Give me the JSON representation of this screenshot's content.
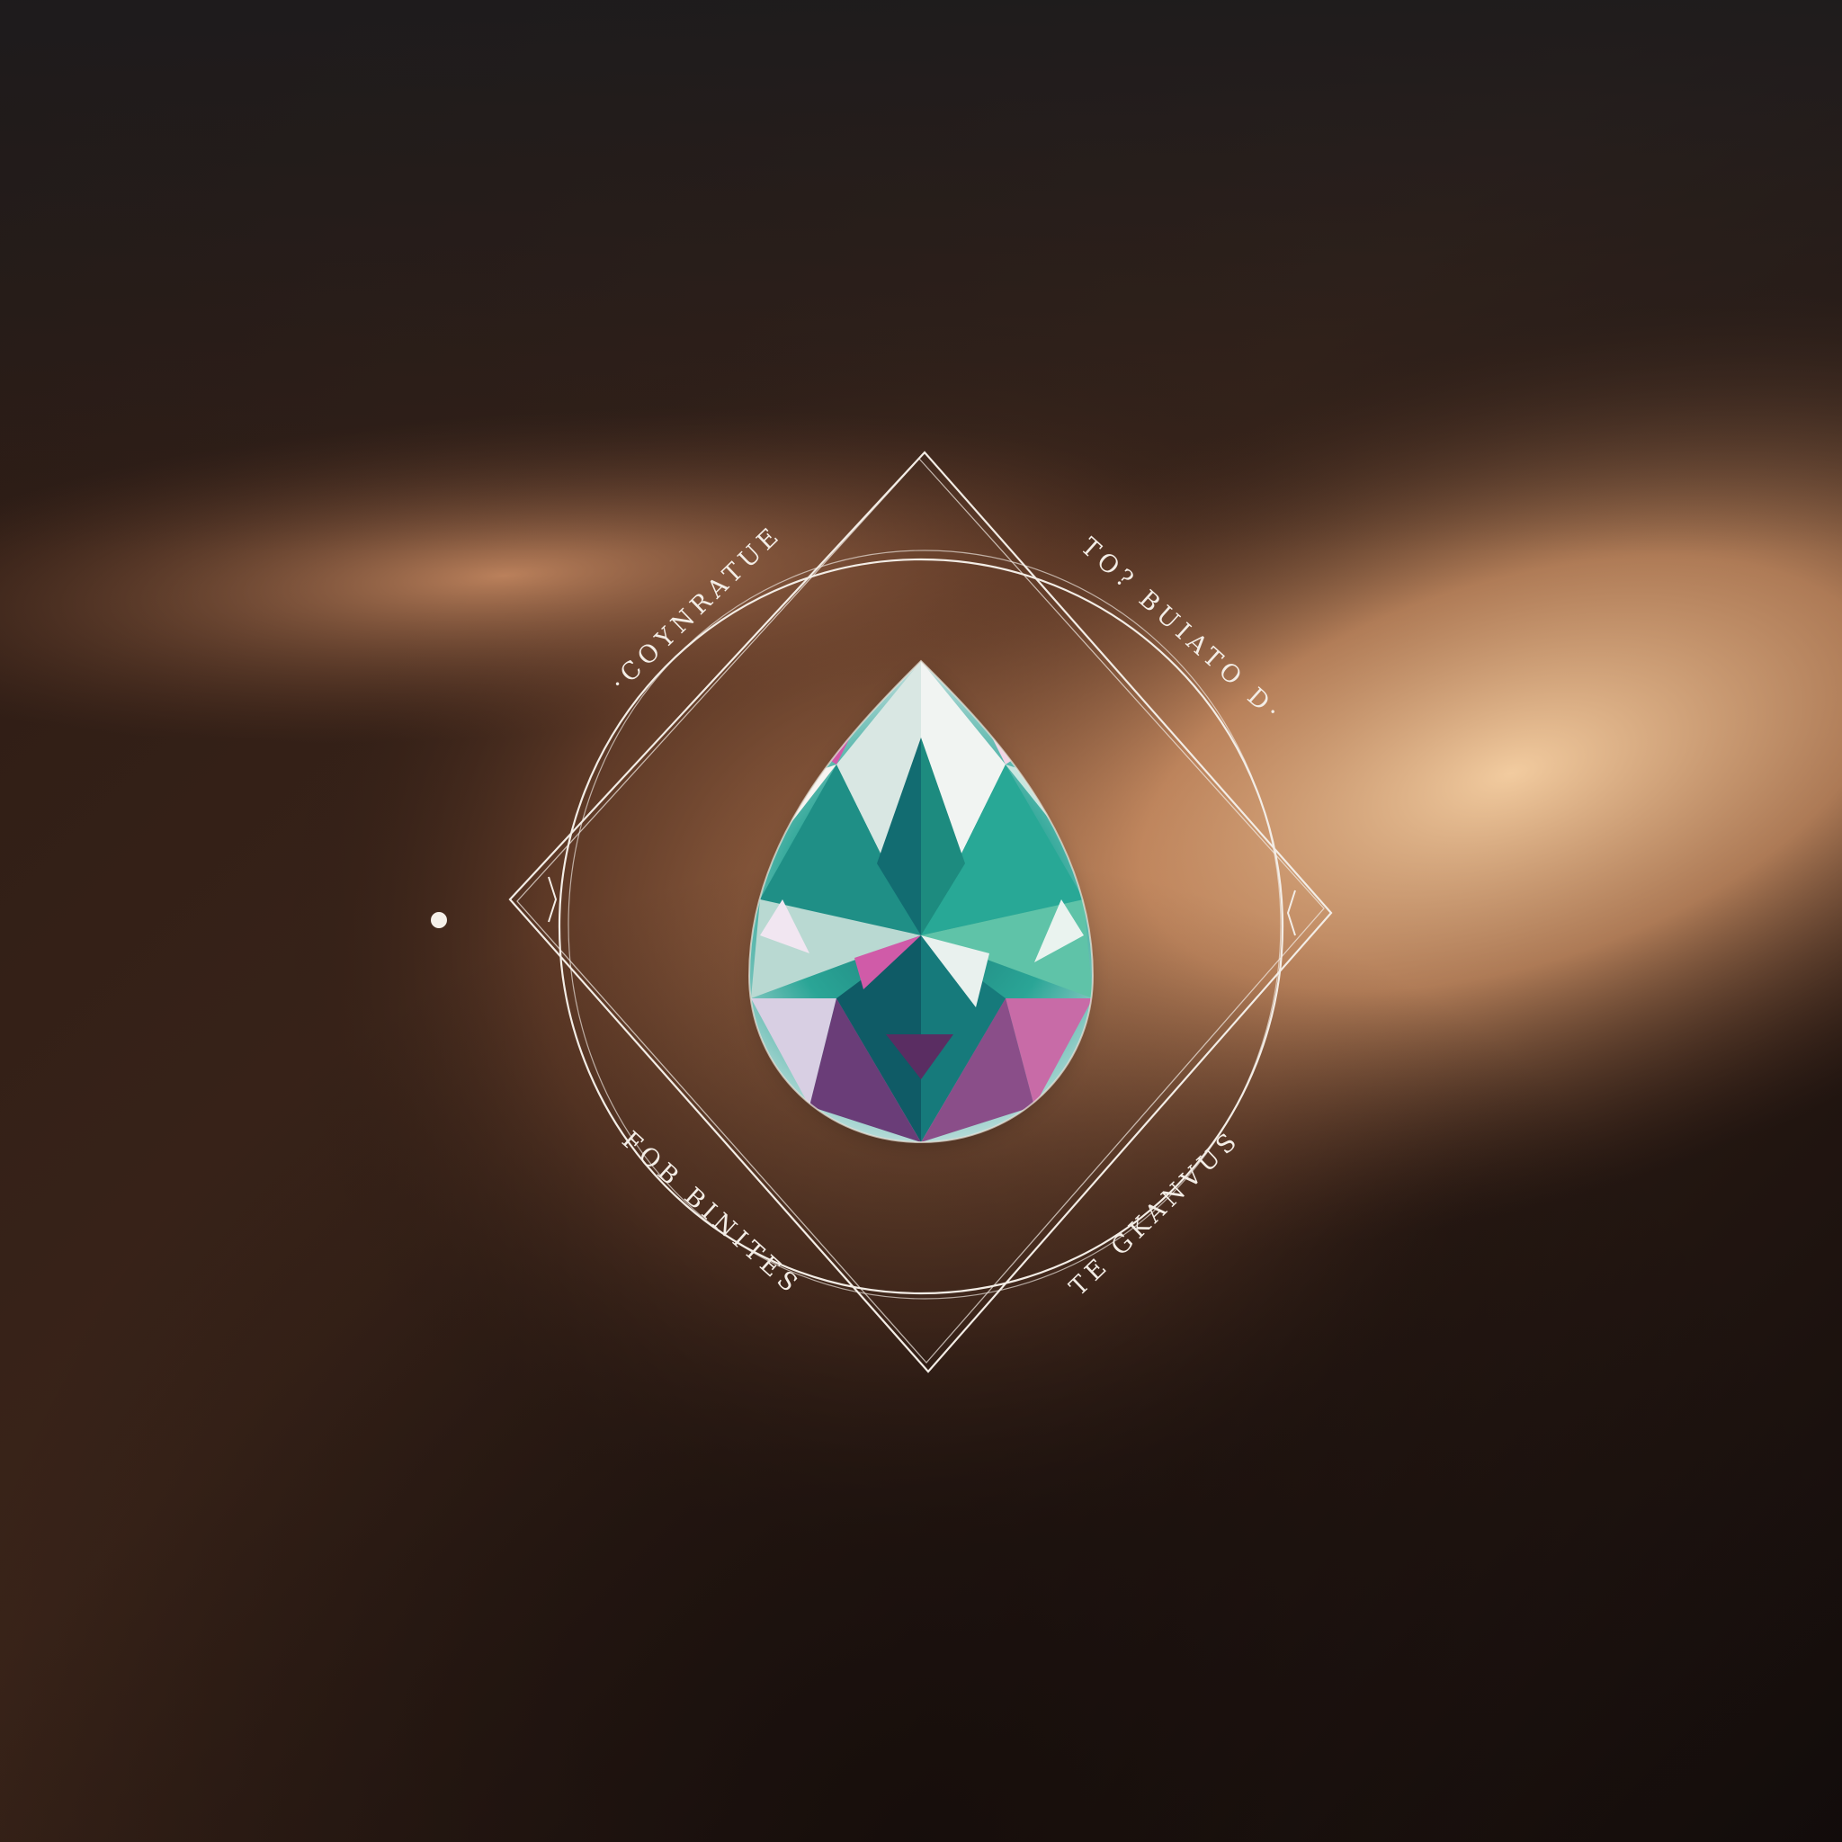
{
  "artwork": {
    "kind": "gemstone-emblem",
    "gem_shape": "pear",
    "gem_cut": "faceted",
    "frame": "diamond-square-with-circle",
    "labels": {
      "upper_left": "·COYNRATUE",
      "upper_right": "TO? BUIATO D·",
      "lower_left": "FOB BINITES",
      "lower_right": "TE GKANVUS"
    }
  },
  "colors": {
    "background_dark": "#140d0b",
    "background_glow": "#f2c295",
    "line": "#f3ede6",
    "gem_teal": "#1f8f86",
    "gem_magenta": "#d05ba8",
    "gem_white": "#eef4f0"
  }
}
